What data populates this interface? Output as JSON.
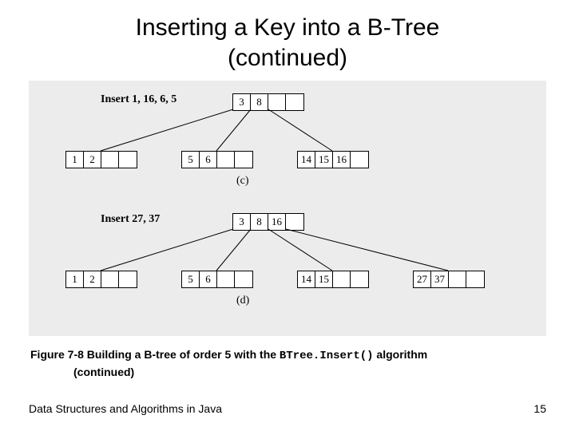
{
  "title_line1": "Inserting a Key into a B-Tree",
  "title_line2": "(continued)",
  "diagram_c": {
    "label": "Insert 1, 16, 6, 5",
    "root": [
      "3",
      "8",
      "",
      ""
    ],
    "children": [
      [
        "1",
        "2",
        "",
        ""
      ],
      [
        "5",
        "6",
        "",
        ""
      ],
      [
        "14",
        "15",
        "16",
        ""
      ]
    ],
    "subfig": "(c)"
  },
  "diagram_d": {
    "label": "Insert 27, 37",
    "root": [
      "3",
      "8",
      "16",
      ""
    ],
    "children": [
      [
        "1",
        "2",
        "",
        ""
      ],
      [
        "5",
        "6",
        "",
        ""
      ],
      [
        "14",
        "15",
        "",
        ""
      ],
      [
        "27",
        "37",
        "",
        ""
      ]
    ],
    "subfig": "(d)"
  },
  "caption_prefix": "Figure 7-8 Building a B-tree of order 5 with the ",
  "caption_code": "BTree.Insert()",
  "caption_suffix": " algorithm",
  "caption_cont": "(continued)",
  "footer_left": "Data Structures and Algorithms in Java",
  "footer_right": "15"
}
